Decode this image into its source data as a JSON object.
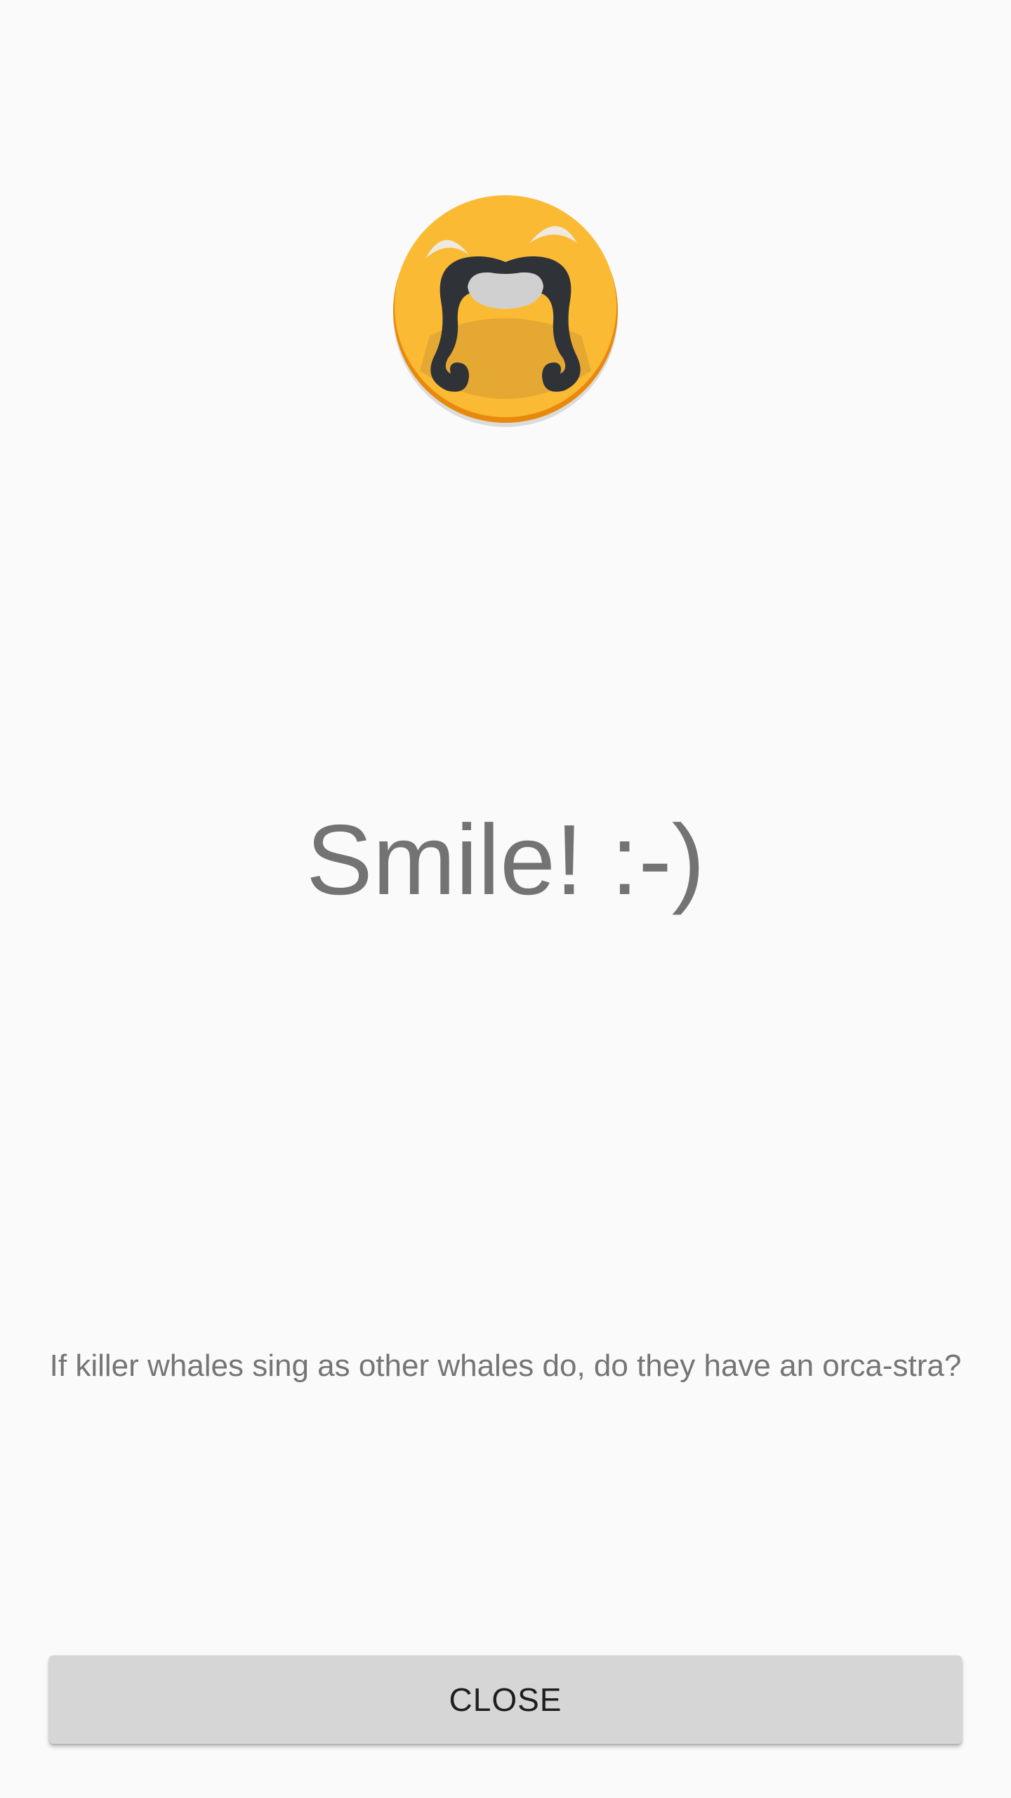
{
  "logo": {
    "icon": "mustache-face-icon",
    "colors": {
      "face": "#fbba33",
      "face_rim": "#e8890d",
      "hair": "#2f3338",
      "eyes": "#e9e6e0",
      "skin": "#d0d0d0"
    }
  },
  "main": {
    "title": "Smile! :-)",
    "joke": "If killer whales sing as other whales do, do they have an orca-stra?"
  },
  "footer": {
    "close_label": "CLOSE"
  }
}
